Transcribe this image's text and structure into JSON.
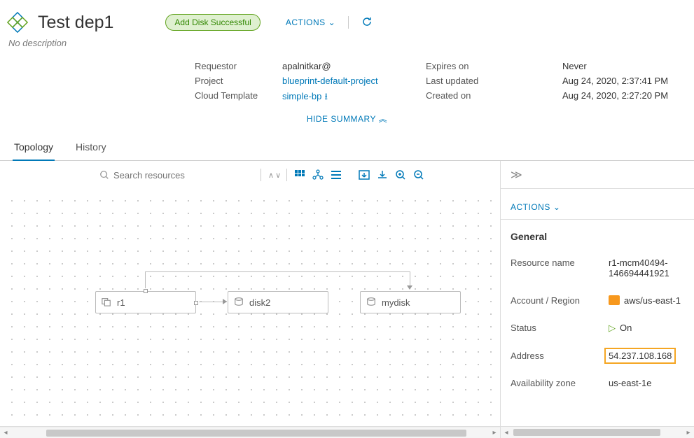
{
  "header": {
    "title": "Test dep1",
    "badge": "Add Disk Successful",
    "actions_label": "ACTIONS",
    "description": "No description"
  },
  "summary": {
    "requestor_label": "Requestor",
    "requestor_value": "apalnitkar@",
    "project_label": "Project",
    "project_value": "blueprint-default-project",
    "template_label": "Cloud Template",
    "template_value": "simple-bp",
    "expires_label": "Expires on",
    "expires_value": "Never",
    "updated_label": "Last updated",
    "updated_value": "Aug 24, 2020, 2:37:41 PM",
    "created_label": "Created on",
    "created_value": "Aug 24, 2020, 2:27:20 PM",
    "hide_label": "HIDE SUMMARY"
  },
  "tabs": {
    "topology": "Topology",
    "history": "History"
  },
  "toolbar": {
    "search_placeholder": "Search resources"
  },
  "canvas": {
    "node1": "r1",
    "node2": "disk2",
    "node3": "mydisk"
  },
  "panel": {
    "actions_label": "ACTIONS",
    "general_label": "General",
    "rows": {
      "resource_name_k": "Resource name",
      "resource_name_v": "r1-mcm40494-146694441921",
      "account_k": "Account / Region",
      "account_v": "aws/us-east-1",
      "status_k": "Status",
      "status_v": "On",
      "address_k": "Address",
      "address_v": "54.237.108.168",
      "az_k": "Availability zone",
      "az_v": "us-east-1e"
    }
  }
}
